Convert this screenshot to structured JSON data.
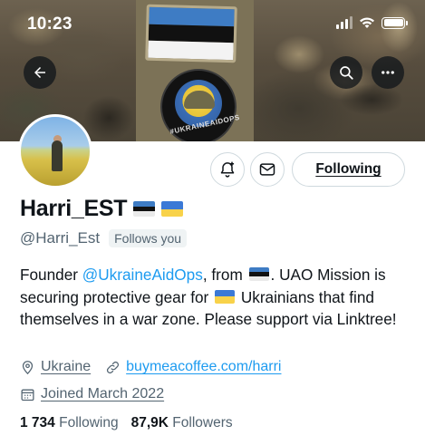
{
  "status_bar": {
    "time": "10:23"
  },
  "banner": {
    "patch_text": "#UKRAINEAIDOPS"
  },
  "header_icons": {
    "back": "arrow-left-icon",
    "search": "search-icon",
    "more": "more-horizontal-icon"
  },
  "actions": {
    "notify_icon": "bell-plus-icon",
    "message_icon": "envelope-icon",
    "follow_label": "Following"
  },
  "profile": {
    "name": "Harri_EST",
    "handle": "@Harri_Est",
    "follows_you": "Follows you",
    "bio": {
      "part1": "Founder ",
      "mention": "@UkraineAidOps",
      "part2": ", from ",
      "part3": ". UAO Mission is securing protective gear for ",
      "part4": " Ukrainians that find themselves in a war zone. Please support via Linktree!"
    },
    "location": "Ukraine",
    "website": "buymeacoffee.com/harri",
    "joined": "Joined March 2022",
    "following_count": "1 734",
    "following_label": "Following",
    "followers_count": "87,9K",
    "followers_label": "Followers"
  },
  "colors": {
    "accent": "#1d9bf0",
    "secondary_text": "#536471",
    "primary_text": "#0f1419",
    "estonia_blue": "#3e7cc4",
    "ukraine_blue": "#3b79d6",
    "ukraine_yellow": "#f8d24a"
  }
}
